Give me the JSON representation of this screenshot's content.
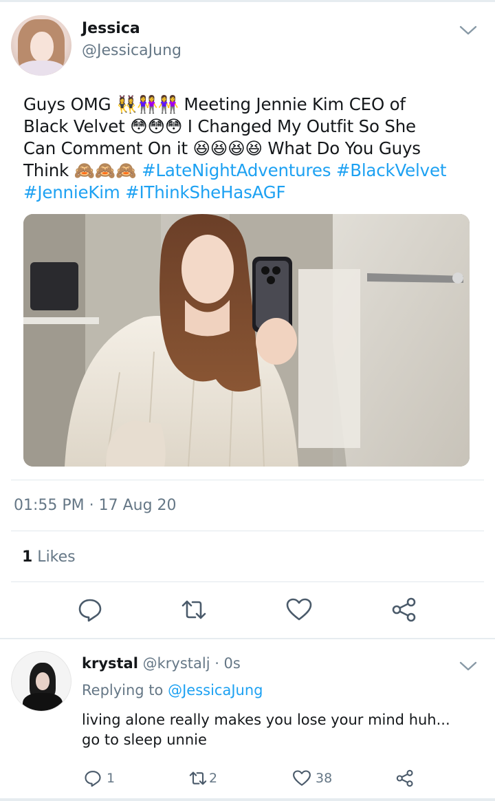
{
  "tweet": {
    "author_name": "Jessica",
    "author_handle": "@JessicaJung",
    "text_lines": [
      [
        {
          "t": "Guys OMG 👯‍♀️👭👭 Meeting Jennie Kim CEO of",
          "tag": false
        }
      ],
      [
        {
          "t": "Black Velvet 😳😳😳 I Changed My Outfit So She",
          "tag": false
        }
      ],
      [
        {
          "t": "Can Comment On it 😆😆😆😆 What Do You Guys",
          "tag": false
        }
      ],
      [
        {
          "t": "Think 🙈🙈🙈 ",
          "tag": false
        },
        {
          "t": "#LateNightAdventures",
          "tag": true
        },
        {
          "t": " ",
          "tag": false
        },
        {
          "t": "#BlackVelvet",
          "tag": true
        }
      ],
      [
        {
          "t": "#JennieKim",
          "tag": true
        },
        {
          "t": " ",
          "tag": false
        },
        {
          "t": "#IThinkSheHasAGF",
          "tag": true
        }
      ]
    ],
    "timestamp": "01:55 PM · 17 Aug 20",
    "likes_count": "1",
    "likes_label": " Likes",
    "actions": [
      "reply",
      "retweet",
      "like",
      "share"
    ]
  },
  "reply": {
    "author_name": "krystal",
    "meta": " @krystalj · 0s",
    "replying_prefix": "Replying to ",
    "replying_to": "@JessicaJung",
    "text_lines": [
      "living alone really makes you lose your mind huh...",
      "go to sleep unnie"
    ],
    "reply_count": "1",
    "retweet_count": "2",
    "like_count": "38"
  },
  "colors": {
    "link": "#1da1f2",
    "secondary_text": "#657786",
    "primary_text": "#14171a",
    "icon": "#4a5a6a",
    "divider": "#e1e8ed"
  }
}
